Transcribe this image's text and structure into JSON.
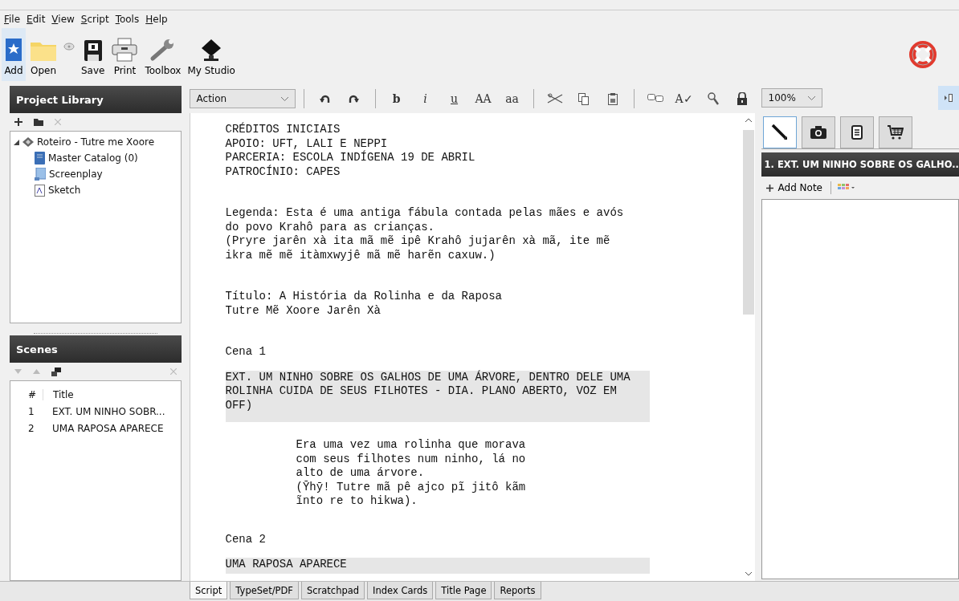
{
  "menu": [
    "File",
    "Edit",
    "View",
    "Script",
    "Tools",
    "Help"
  ],
  "toolbar": [
    {
      "kind": "add",
      "label": "Add",
      "selected": true
    },
    {
      "kind": "open",
      "label": "Open",
      "selected": false
    },
    {
      "kind": "disc",
      "selected": false
    },
    {
      "kind": "save",
      "label": "Save",
      "selected": false
    },
    {
      "kind": "print",
      "label": "Print",
      "selected": false
    },
    {
      "kind": "toolbox",
      "label": "Toolbox",
      "selected": false
    },
    {
      "kind": "studio",
      "label": "My Studio",
      "selected": false
    }
  ],
  "format_bar": {
    "style": "Action",
    "buttons": [
      {
        "kind": "undo"
      },
      {
        "kind": "redo"
      },
      {
        "kind": "sep"
      },
      {
        "kind": "bold",
        "label": "b"
      },
      {
        "kind": "italic",
        "label": "i"
      },
      {
        "kind": "underline",
        "label": "u"
      },
      {
        "kind": "plain",
        "label": "AA"
      },
      {
        "kind": "plain",
        "label": "aa"
      },
      {
        "kind": "sep"
      },
      {
        "kind": "cut"
      },
      {
        "kind": "copy"
      },
      {
        "kind": "paste"
      },
      {
        "kind": "sep"
      },
      {
        "kind": "bubbles"
      },
      {
        "kind": "plain",
        "label": "A✓"
      },
      {
        "kind": "search"
      },
      {
        "kind": "lock"
      }
    ]
  },
  "zoom": "100%",
  "project_library": {
    "title": "Project Library",
    "tree": [
      {
        "label": "Roteiro - Tutre me Xoore",
        "kind": "project",
        "expanded": true,
        "children": [
          {
            "label": "Master Catalog (0)",
            "kind": "catalog"
          },
          {
            "label": "Screenplay",
            "kind": "screenplay"
          },
          {
            "label": "Sketch",
            "kind": "sketch"
          }
        ]
      }
    ]
  },
  "scenes": {
    "title": "Scenes",
    "columns": [
      "#",
      "Title"
    ],
    "rows": [
      {
        "number": "1",
        "title": "EXT. UM NINHO SOBR..."
      },
      {
        "number": "2",
        "title": "UMA RAPOSA APARECE"
      }
    ]
  },
  "script": [
    {
      "kind": "general",
      "lines": [
        "CRÉDITOS INICIAIS",
        "APOIO: UFT, LALI E NEPPI",
        "PARCERIA: ESCOLA INDÍGENA 19 DE ABRIL",
        "PATROCÍNIO: CAPES"
      ]
    },
    {
      "kind": "general",
      "lines": [
        "Legenda: Esta é uma antiga fábula contada pelas mães e avós",
        "do povo Krahô para as crianças.",
        "(Pryre jarên xà ita mã mẽ ipê Krahô jujarên xà mã, ite mẽ",
        "ikra mẽ mẽ itàmxwyjê mã mẽ harẽn caxuw.)"
      ]
    },
    {
      "kind": "general",
      "lines": [
        "Título: A História da Rolinha e da Raposa",
        "Tutre Mẽ Xoore Jarên Xà"
      ]
    },
    {
      "kind": "general",
      "lines": [
        "Cena 1"
      ]
    },
    {
      "kind": "heading",
      "lines": [
        "EXT. UM NINHO SOBRE OS GALHOS DE UMA ÁRVORE, DENTRO DELE UMA",
        "ROLINHA CUIDA DE SEUS FILHOTES - DIA. PLANO ABERTO, VOZ EM",
        "OFF)"
      ]
    },
    {
      "kind": "dialogue",
      "lines": [
        "Era uma vez uma rolinha que morava",
        "com seus filhotes num ninho, lá no",
        "alto de uma árvore.",
        "(Ȳhȳ! Tutre mã pê ajco pĩ jitô kãm",
        "ĩnto re to hikwa)."
      ]
    },
    {
      "kind": "general",
      "lines": [
        "Cena 2"
      ]
    },
    {
      "kind": "heading",
      "lines": [
        "UMA RAPOSA APARECE"
      ]
    }
  ],
  "notes": {
    "tabs": [
      {
        "kind": "pen",
        "selected": true
      },
      {
        "kind": "camera",
        "selected": false
      },
      {
        "kind": "document",
        "selected": false
      },
      {
        "kind": "cart",
        "selected": false
      }
    ],
    "header": "1. EXT. UM NINHO SOBRE OS GALHO..",
    "add_note": "Add Note"
  },
  "bottom_tabs": [
    {
      "label": "Script",
      "selected": true
    },
    {
      "label": "TypeSet/PDF",
      "selected": false
    },
    {
      "label": "Scratchpad",
      "selected": false
    },
    {
      "label": "Index Cards",
      "selected": false
    },
    {
      "label": "Title Page",
      "selected": false
    },
    {
      "label": "Reports",
      "selected": false
    }
  ]
}
